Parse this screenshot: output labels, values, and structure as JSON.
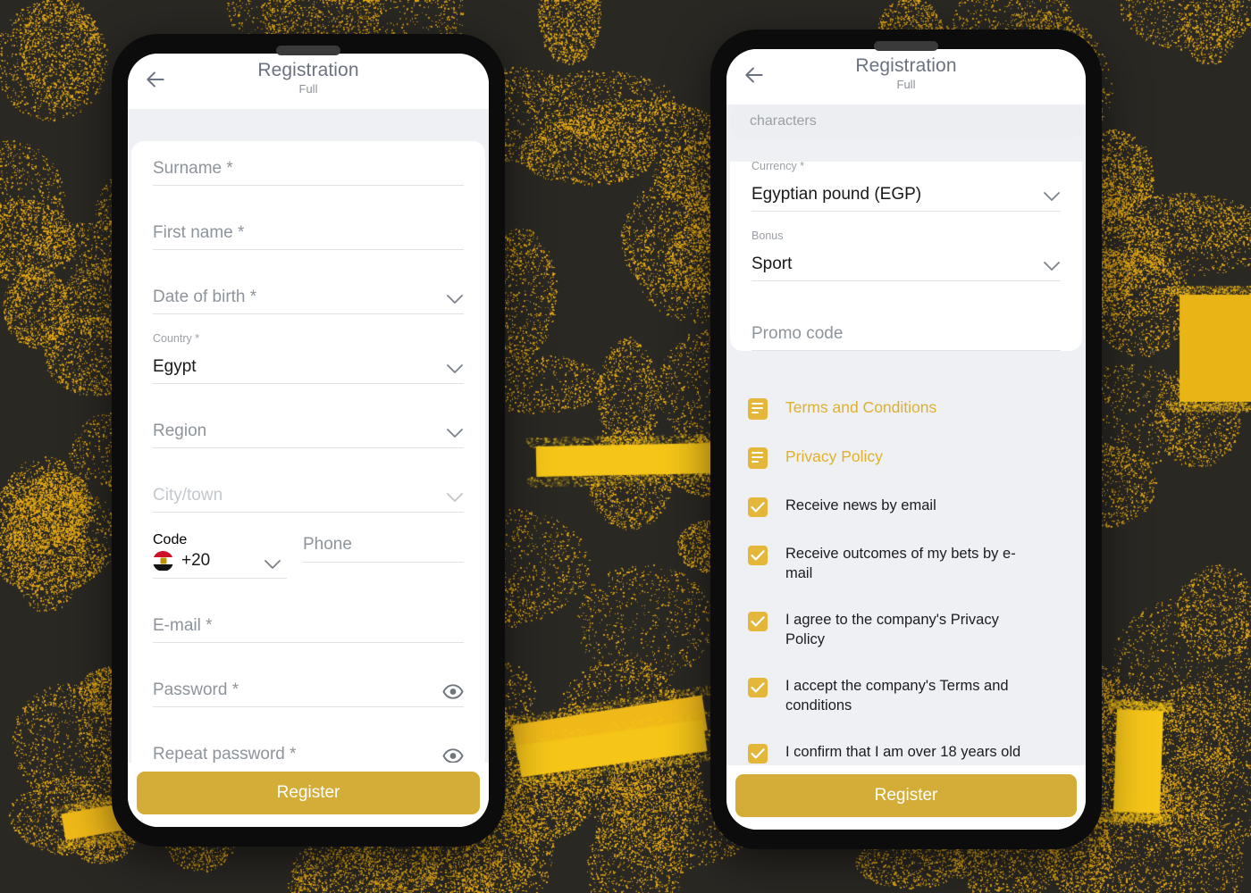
{
  "theme": {
    "accent_gold": "#e4b63a",
    "button_gold": "#d3ad37",
    "link_gold": "#e0b02c",
    "bg_dark": "#2a2823",
    "bg_speckle": "#e8aa12",
    "screen_bg": "#eef0f3",
    "card_white": "#ffffff"
  },
  "phone_left": {
    "header": {
      "back_icon": "arrow-left-icon",
      "title": "Registration",
      "subtitle": "Full"
    },
    "fields": [
      {
        "key": "surname",
        "placeholder": "Surname *",
        "label": "",
        "value": "",
        "control": "text"
      },
      {
        "key": "first_name",
        "placeholder": "First name *",
        "label": "",
        "value": "",
        "control": "text"
      },
      {
        "key": "date_of_birth",
        "placeholder": "Date of birth *",
        "label": "",
        "value": "",
        "control": "select"
      },
      {
        "key": "country",
        "placeholder": "",
        "label": "Country *",
        "value": "Egypt",
        "control": "select"
      },
      {
        "key": "region",
        "placeholder": "Region",
        "label": "",
        "value": "",
        "control": "select"
      },
      {
        "key": "city_town",
        "placeholder": "City/town",
        "label": "",
        "value": "",
        "control": "select",
        "disabled": true
      },
      {
        "key": "email",
        "placeholder": "E-mail *",
        "label": "",
        "value": "",
        "control": "text"
      },
      {
        "key": "password",
        "placeholder": "Password *",
        "label": "",
        "value": "",
        "control": "password"
      },
      {
        "key": "repeat_password",
        "placeholder": "Repeat password *",
        "label": "",
        "value": "",
        "control": "password"
      }
    ],
    "phone_row": {
      "code_label": "Code",
      "code_value": "+20",
      "flag_icon": "egypt-flag-icon",
      "phone_placeholder": "Phone"
    },
    "register_label": "Register"
  },
  "phone_right": {
    "header": {
      "back_icon": "arrow-left-icon",
      "title": "Registration",
      "subtitle": "Full"
    },
    "hint": {
      "clipped_line": "",
      "visible_text": "characters"
    },
    "fields": [
      {
        "key": "currency",
        "label": "Currency *",
        "value": "Egyptian pound (EGP)",
        "placeholder": "",
        "control": "select"
      },
      {
        "key": "bonus",
        "label": "Bonus",
        "value": "Sport",
        "placeholder": "",
        "control": "select"
      },
      {
        "key": "promo_code",
        "label": "",
        "value": "",
        "placeholder": "Promo code",
        "control": "text"
      }
    ],
    "links": [
      {
        "icon": "document-icon",
        "label": "Terms and Conditions"
      },
      {
        "icon": "document-icon",
        "label": "Privacy Policy"
      }
    ],
    "checkboxes": [
      {
        "label": "Receive news by email",
        "checked": true
      },
      {
        "label": "Receive outcomes of my bets by e-mail",
        "checked": true
      },
      {
        "label": "I agree to the company's Privacy Policy",
        "checked": true
      },
      {
        "label": "I accept the company's Terms and conditions",
        "checked": true
      },
      {
        "label": "I confirm that I am over 18 years old",
        "checked": true
      }
    ],
    "register_label": "Register"
  }
}
